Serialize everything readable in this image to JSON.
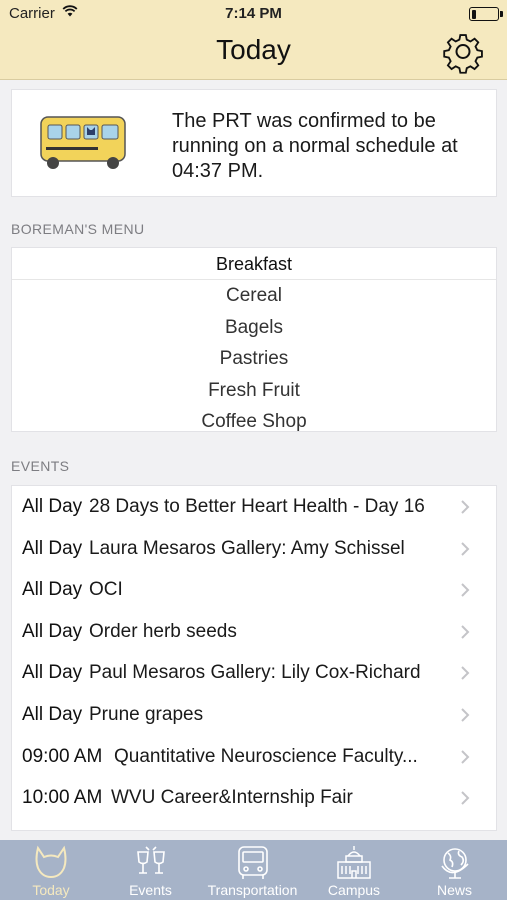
{
  "status_bar": {
    "carrier": "Carrier",
    "time": "7:14 PM"
  },
  "nav": {
    "title": "Today"
  },
  "alert": {
    "message": "The PRT was confirmed to be running on a normal schedule at 04:37 PM."
  },
  "menu_section": {
    "label": "BOREMAN'S MENU",
    "meal": "Breakfast",
    "items": [
      "Cereal",
      "Bagels",
      "Pastries",
      "Fresh Fruit",
      "Coffee Shop"
    ]
  },
  "events_section": {
    "label": "EVENTS",
    "events": [
      {
        "time": "All Day",
        "title": "28 Days to Better Heart Health - Day 16"
      },
      {
        "time": "All Day",
        "title": "Laura Mesaros Gallery: Amy Schissel"
      },
      {
        "time": "All Day",
        "title": "OCI"
      },
      {
        "time": "All Day",
        "title": "Order herb seeds"
      },
      {
        "time": "All Day",
        "title": "Paul Mesaros Gallery: Lily Cox-Richard"
      },
      {
        "time": "All Day",
        "title": "Prune grapes"
      },
      {
        "time": "09:00 AM",
        "title": "Quantitative Neuroscience Faculty..."
      },
      {
        "time": "10:00 AM",
        "title": "WVU Career&Internship Fair"
      }
    ]
  },
  "tabs": [
    {
      "label": "Today",
      "icon": "cat-icon",
      "active": true
    },
    {
      "label": "Events",
      "icon": "glasses-icon",
      "active": false
    },
    {
      "label": "Transportation",
      "icon": "bus-icon",
      "active": false
    },
    {
      "label": "Campus",
      "icon": "building-icon",
      "active": false
    },
    {
      "label": "News",
      "icon": "globe-icon",
      "active": false
    }
  ],
  "colors": {
    "header_bg": "#f5e9bf",
    "tab_bar_bg": "#a6b3c8",
    "active_tab": "#f5e9bf",
    "bus_body": "#f2d35a",
    "bus_window": "#a9d3ea"
  }
}
